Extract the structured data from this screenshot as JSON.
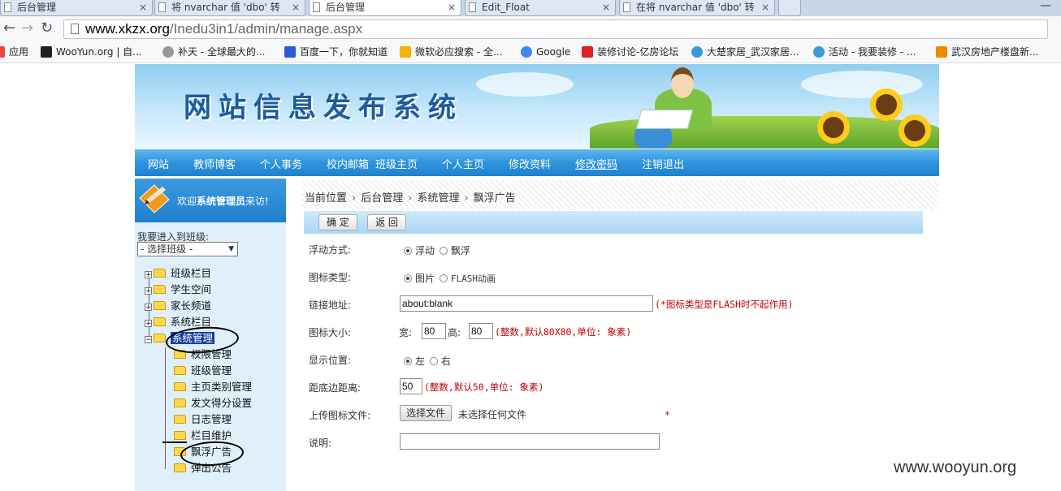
{
  "browser": {
    "tabs": [
      {
        "title": "后台管理",
        "active": false
      },
      {
        "title": "将 nvarchar 值 'dbo' 转",
        "active": false
      },
      {
        "title": "后台管理",
        "active": true
      },
      {
        "title": "Edit_Float",
        "active": false
      },
      {
        "title": "在将 nvarchar 值 'dbo' 转",
        "active": false
      }
    ],
    "url_host": "www.xkzx.org",
    "url_path": "/Inedu3in1/admin/manage.aspx",
    "bookmarks": [
      {
        "label": "应用",
        "icon_color": "#e44"
      },
      {
        "label": "WooYun.org | 自...",
        "icon_color": "#222"
      },
      {
        "label": "补天 - 全球最大的...",
        "icon_color": "#999"
      },
      {
        "label": "百度一下，你就知道",
        "icon_color": "#2a5cd8"
      },
      {
        "label": "微软必应搜索 - 全...",
        "icon_color": "#f2b200"
      },
      {
        "label": "Google",
        "icon_color": "#4285f4"
      },
      {
        "label": "装修讨论-亿房论坛",
        "icon_color": "#d22"
      },
      {
        "label": "大楚家居_武汉家居...",
        "icon_color": "#3a9ad9"
      },
      {
        "label": "活动 - 我要装修 - ...",
        "icon_color": "#3a9ad9"
      },
      {
        "label": "武汉房地产楼盘新...",
        "icon_color": "#f08a00"
      }
    ]
  },
  "banner": {
    "title": "网站信息发布系统"
  },
  "nav": [
    "网站",
    "教师博客",
    "个人事务",
    "校内邮箱",
    "班级主页",
    "个人主页",
    "修改资料",
    "修改密码",
    "注销退出"
  ],
  "sidebar": {
    "welcome_pre": "欢迎",
    "welcome_role": "系统管理员",
    "welcome_post": "来访!",
    "class_label": "我要进入到班级:",
    "class_select": "- 选择班级 -",
    "tree": [
      "班级栏目",
      "学生空间",
      "家长频道",
      "系统栏目",
      "系统管理"
    ],
    "subtree": [
      "权限管理",
      "班级管理",
      "主页类别管理",
      "发文得分设置",
      "日志管理",
      "栏目维护",
      "飘浮广告",
      "弹出公告"
    ]
  },
  "breadcrumb": [
    "当前位置",
    "后台管理",
    "系统管理",
    "飘浮广告"
  ],
  "buttons": {
    "ok": "确 定",
    "back": "返 回"
  },
  "form": {
    "float_mode_label": "浮动方式:",
    "float_mode_options": [
      "浮动",
      "飘浮"
    ],
    "icon_type_label": "图标类型:",
    "icon_type_options": [
      "图片",
      "FLASH动画"
    ],
    "link_label": "链接地址:",
    "link_value": "about:blank",
    "link_hint": "(*图标类型是FLASH时不起作用)",
    "size_label": "图标大小:",
    "width_label": "宽:",
    "width_value": "80",
    "height_label": "高:",
    "height_value": "80",
    "size_hint": "(整数,默认80X80,单位: 象素)",
    "position_label": "显示位置:",
    "position_options": [
      "左",
      "右"
    ],
    "bottom_label": "距底边距离:",
    "bottom_value": "50",
    "bottom_hint": "(整数,默认50,单位: 象素)",
    "upload_label": "上传图标文件:",
    "upload_button": "选择文件",
    "upload_status": "未选择任何文件",
    "required_mark": "*",
    "desc_label": "说明:",
    "desc_value": ""
  },
  "watermark": "www.wooyun.org"
}
